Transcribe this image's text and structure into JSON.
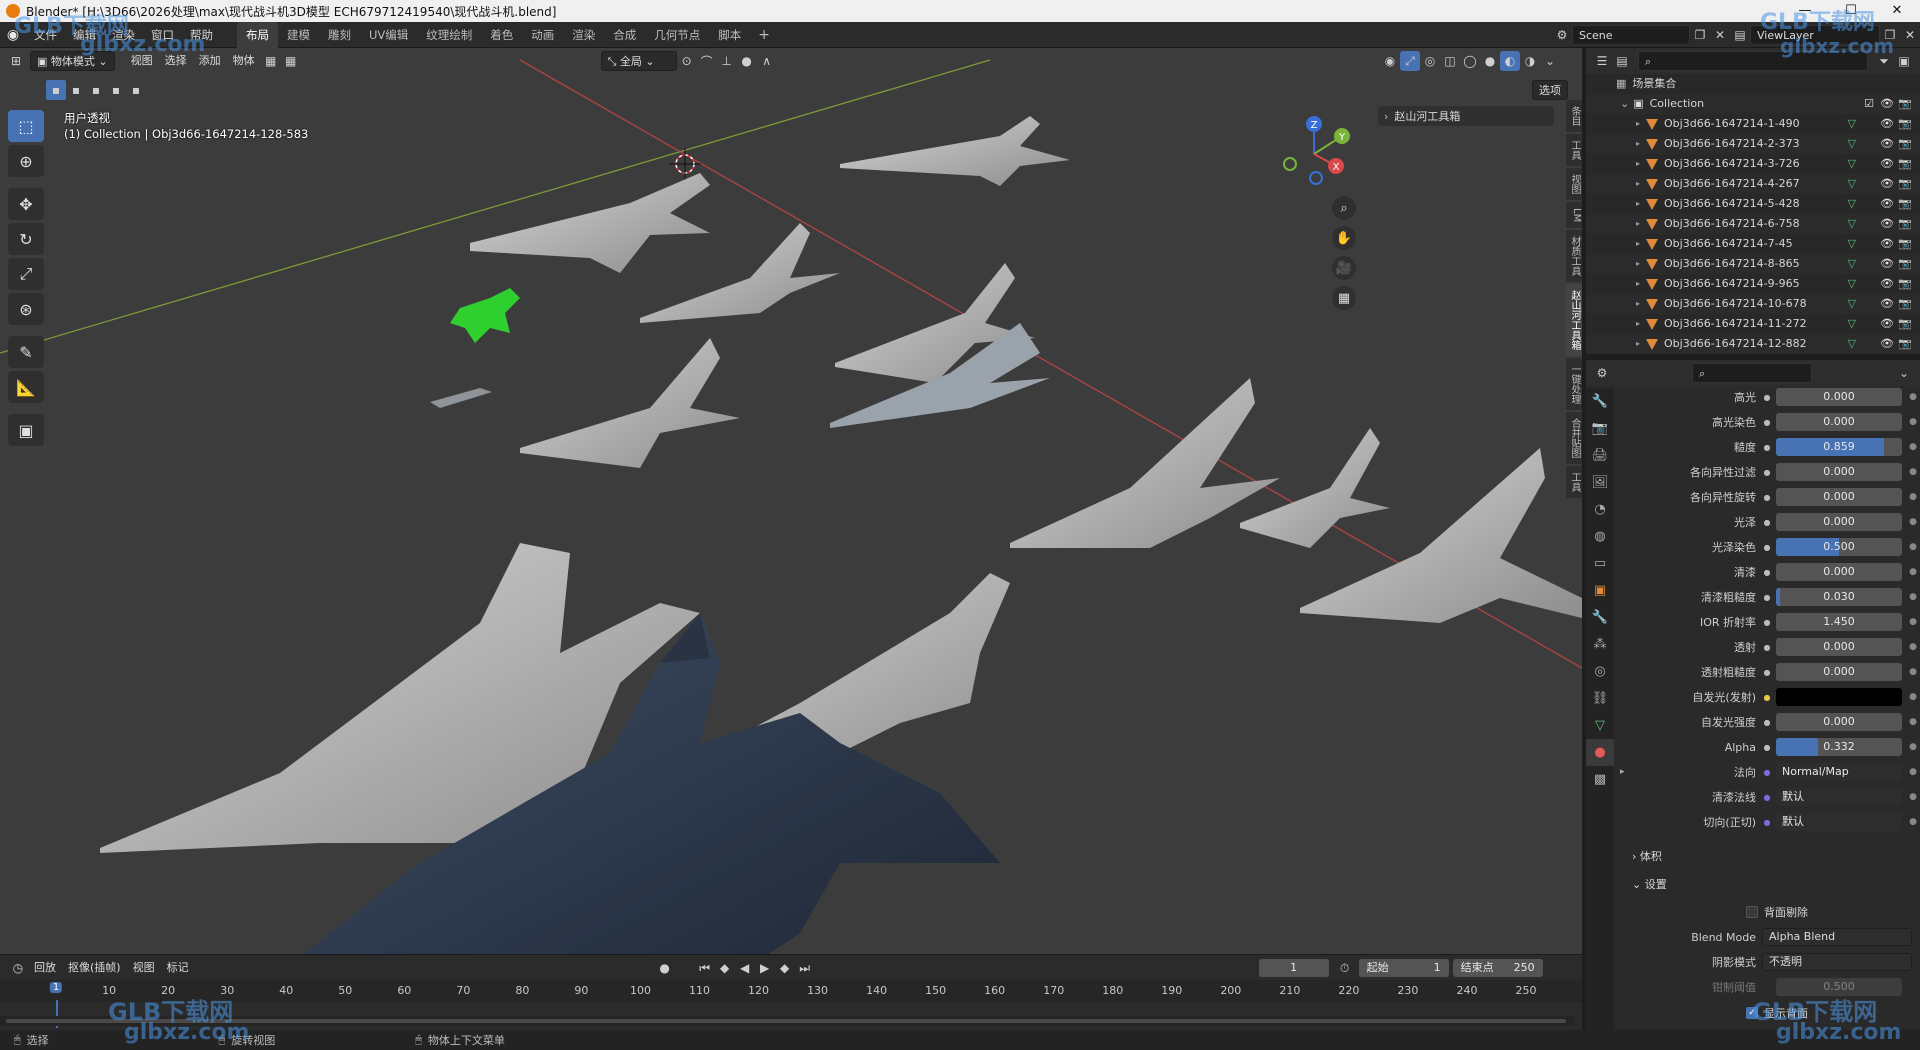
{
  "window": {
    "title": "Blender* [H:\\3D66\\2026处理\\max\\现代战斗机3D模型 ECH679712419540\\现代战斗机.blend]"
  },
  "menu": {
    "items": [
      "文件",
      "编辑",
      "渲染",
      "窗口",
      "帮助"
    ],
    "workspaces": [
      "布局",
      "建模",
      "雕刻",
      "UV编辑",
      "纹理绘制",
      "着色",
      "动画",
      "渲染",
      "合成",
      "几何节点",
      "脚本"
    ],
    "active_workspace": "布局",
    "scene": "Scene",
    "view_layer": "ViewLayer"
  },
  "viewport_header": {
    "mode": "物体模式",
    "menus": [
      "视图",
      "选择",
      "添加",
      "物体"
    ],
    "transform_orientation": "全局",
    "options": "选项"
  },
  "viewport": {
    "view_name": "用户透视",
    "collection_info": "(1) Collection | Obj3d66-1647214-128-583",
    "sidebar_panel": "赵山河工具箱",
    "gizmo": {
      "x": "X",
      "y": "Y",
      "z": "Z"
    },
    "n_tabs": [
      "条目",
      "工具",
      "视图",
      "LM",
      "材质工具",
      "赵山河工具箱",
      "一键处理",
      "合并贴图",
      "工具"
    ]
  },
  "outliner": {
    "root": "场景集合",
    "collection": "Collection",
    "objects": [
      "Obj3d66-1647214-1-490",
      "Obj3d66-1647214-2-373",
      "Obj3d66-1647214-3-726",
      "Obj3d66-1647214-4-267",
      "Obj3d66-1647214-5-428",
      "Obj3d66-1647214-6-758",
      "Obj3d66-1647214-7-45",
      "Obj3d66-1647214-8-865",
      "Obj3d66-1647214-9-965",
      "Obj3d66-1647214-10-678",
      "Obj3d66-1647214-11-272",
      "Obj3d66-1647214-12-882"
    ]
  },
  "properties": {
    "rows": [
      {
        "label": "高光",
        "value": "0.000",
        "fill": 0
      },
      {
        "label": "高光染色",
        "value": "0.000",
        "fill": 0
      },
      {
        "label": "糙度",
        "value": "0.859",
        "fill": 0.859
      },
      {
        "label": "各向异性过滤",
        "value": "0.000",
        "fill": 0
      },
      {
        "label": "各向异性旋转",
        "value": "0.000",
        "fill": 0
      },
      {
        "label": "光泽",
        "value": "0.000",
        "fill": 0
      },
      {
        "label": "光泽染色",
        "value": "0.500",
        "fill": 0.5
      },
      {
        "label": "清漆",
        "value": "0.000",
        "fill": 0
      },
      {
        "label": "清漆粗糙度",
        "value": "0.030",
        "fill": 0.03
      },
      {
        "label": "IOR 折射率",
        "value": "1.450",
        "fill": 0
      },
      {
        "label": "透射",
        "value": "0.000",
        "fill": 0
      },
      {
        "label": "透射粗糙度",
        "value": "0.000",
        "fill": 0
      },
      {
        "label": "自发光(发射)",
        "value": "",
        "fill": 0,
        "color": "#000000"
      },
      {
        "label": "自发光强度",
        "value": "0.000",
        "fill": 0
      },
      {
        "label": "Alpha",
        "value": "0.332",
        "fill": 0.332
      },
      {
        "label": "法向",
        "value": "Normal/Map",
        "fill": 0,
        "text": true
      },
      {
        "label": "清漆法线",
        "value": "默认",
        "fill": 0,
        "text": true
      },
      {
        "label": "切向(正切)",
        "value": "默认",
        "fill": 0,
        "text": true
      }
    ],
    "volume_section": "体积",
    "settings_section": "设置",
    "backface_culling": "背面剔除",
    "blend_mode_label": "Blend Mode",
    "blend_mode_value": "Alpha Blend",
    "shadow_mode_label": "阴影模式",
    "shadow_mode_value": "不透明",
    "clip_threshold_label": "钳制阈值",
    "clip_threshold_value": "0.500",
    "show_backface": "显示背面"
  },
  "timeline": {
    "menus": [
      "回放",
      "抠像(插帧)",
      "视图",
      "标记"
    ],
    "current_frame": "1",
    "start_label": "起始",
    "start": "1",
    "end_label": "结束点",
    "end": "250",
    "ruler": [
      "1",
      "10",
      "20",
      "30",
      "40",
      "50",
      "60",
      "70",
      "80",
      "90",
      "100",
      "110",
      "120",
      "130",
      "140",
      "150",
      "160",
      "170",
      "180",
      "190",
      "200",
      "210",
      "220",
      "230",
      "240",
      "250"
    ]
  },
  "status": {
    "left": "选择",
    "middle": "旋转视图",
    "right": "物体上下文菜单"
  },
  "watermark": {
    "brand": "GLB下载网",
    "url": "glbxz.com"
  },
  "colors": {
    "accent": "#4772b3",
    "viewport": "#3c3c3c",
    "orange": "#e08a3a",
    "green_axis": "#6b8f2c",
    "red_axis": "#a23a3a"
  }
}
